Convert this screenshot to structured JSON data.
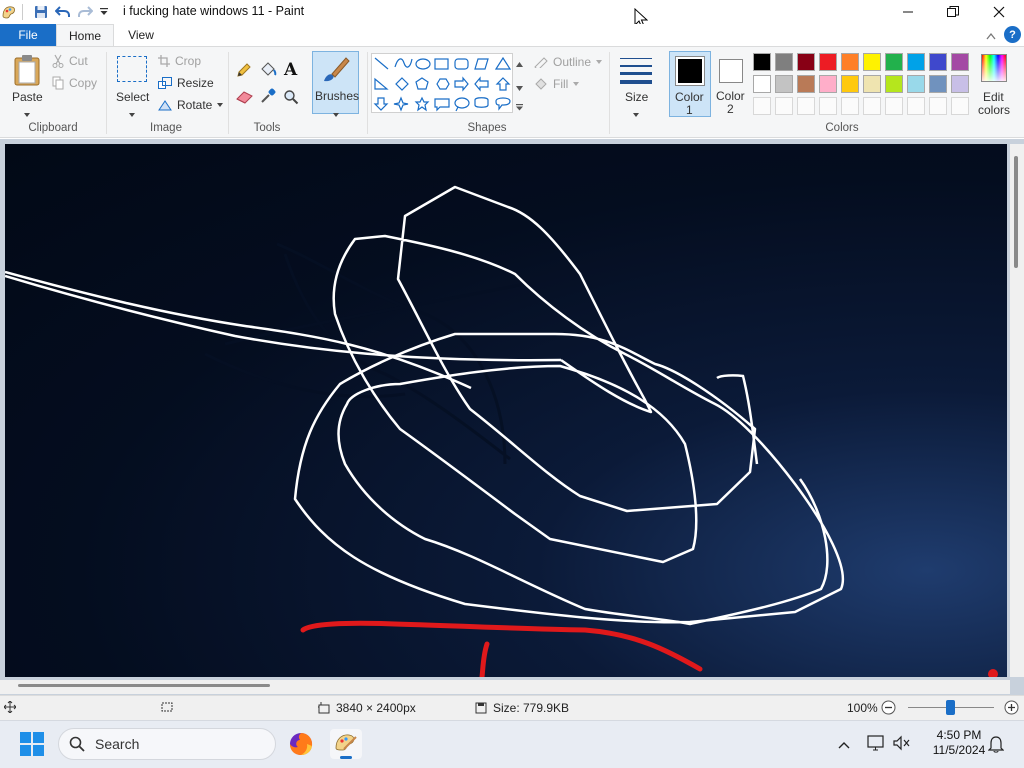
{
  "window": {
    "title": "i fucking hate windows 11 - Paint",
    "controls": {
      "minimize": "minimize-icon",
      "maximize": "restore-icon",
      "close": "close-icon"
    }
  },
  "tabs": [
    {
      "label": "File"
    },
    {
      "label": "Home"
    },
    {
      "label": "View"
    }
  ],
  "ribbon": {
    "clipboard": {
      "group": "Clipboard",
      "paste": "Paste",
      "cut": "Cut",
      "copy": "Copy"
    },
    "image": {
      "group": "Image",
      "select": "Select",
      "crop": "Crop",
      "resize": "Resize",
      "rotate": "Rotate"
    },
    "tools": {
      "group": "Tools"
    },
    "brushes": {
      "label": "Brushes"
    },
    "shapes": {
      "group": "Shapes",
      "outline": "Outline",
      "fill": "Fill"
    },
    "size": {
      "label": "Size"
    },
    "color1": {
      "label": "Color",
      "num": "1"
    },
    "color2": {
      "label": "Color",
      "num": "2"
    },
    "colors": {
      "group": "Colors",
      "edit_line1": "Edit",
      "edit_line2": "colors",
      "palette_row1": [
        "#000000",
        "#7f7f7f",
        "#880015",
        "#ed1c24",
        "#ff7f27",
        "#fff200",
        "#22b14c",
        "#00a2e8",
        "#3f48cc",
        "#a349a4"
      ],
      "palette_row2": [
        "#ffffff",
        "#c3c3c3",
        "#b97a57",
        "#ffaec9",
        "#ffc90e",
        "#efe4b0",
        "#b5e61d",
        "#99d9ea",
        "#7092be",
        "#c8bfe7"
      ]
    }
  },
  "status": {
    "dimensions": "3840 × 2400px",
    "size": "Size: 779.9KB",
    "zoom": "100%"
  },
  "taskbar": {
    "search_label": "Search",
    "time": "4:50 PM",
    "date": "11/5/2024"
  },
  "colors": {
    "accent": "#1a6ec7",
    "brush": "#e0191b"
  }
}
